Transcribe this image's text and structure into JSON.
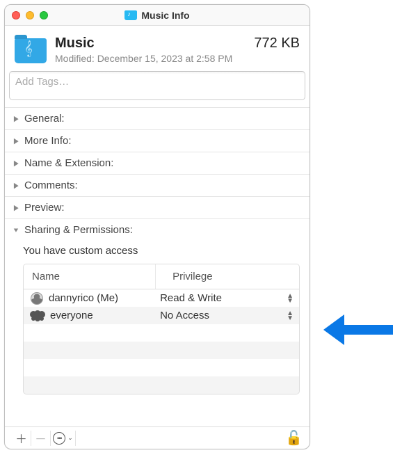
{
  "window": {
    "title": "Music Info"
  },
  "header": {
    "name": "Music",
    "size": "772 KB",
    "modified": "Modified: December 15, 2023 at 2:58 PM"
  },
  "tags": {
    "placeholder": "Add Tags…"
  },
  "sections": {
    "general": "General:",
    "more_info": "More Info:",
    "name_ext": "Name & Extension:",
    "comments": "Comments:",
    "preview": "Preview:",
    "sharing": "Sharing & Permissions:"
  },
  "permissions": {
    "summary": "You have custom access",
    "columns": {
      "name": "Name",
      "privilege": "Privilege"
    },
    "rows": [
      {
        "icon": "user",
        "name": "dannyrico (Me)",
        "privilege": "Read & Write"
      },
      {
        "icon": "group",
        "name": "everyone",
        "privilege": "No Access"
      }
    ]
  }
}
